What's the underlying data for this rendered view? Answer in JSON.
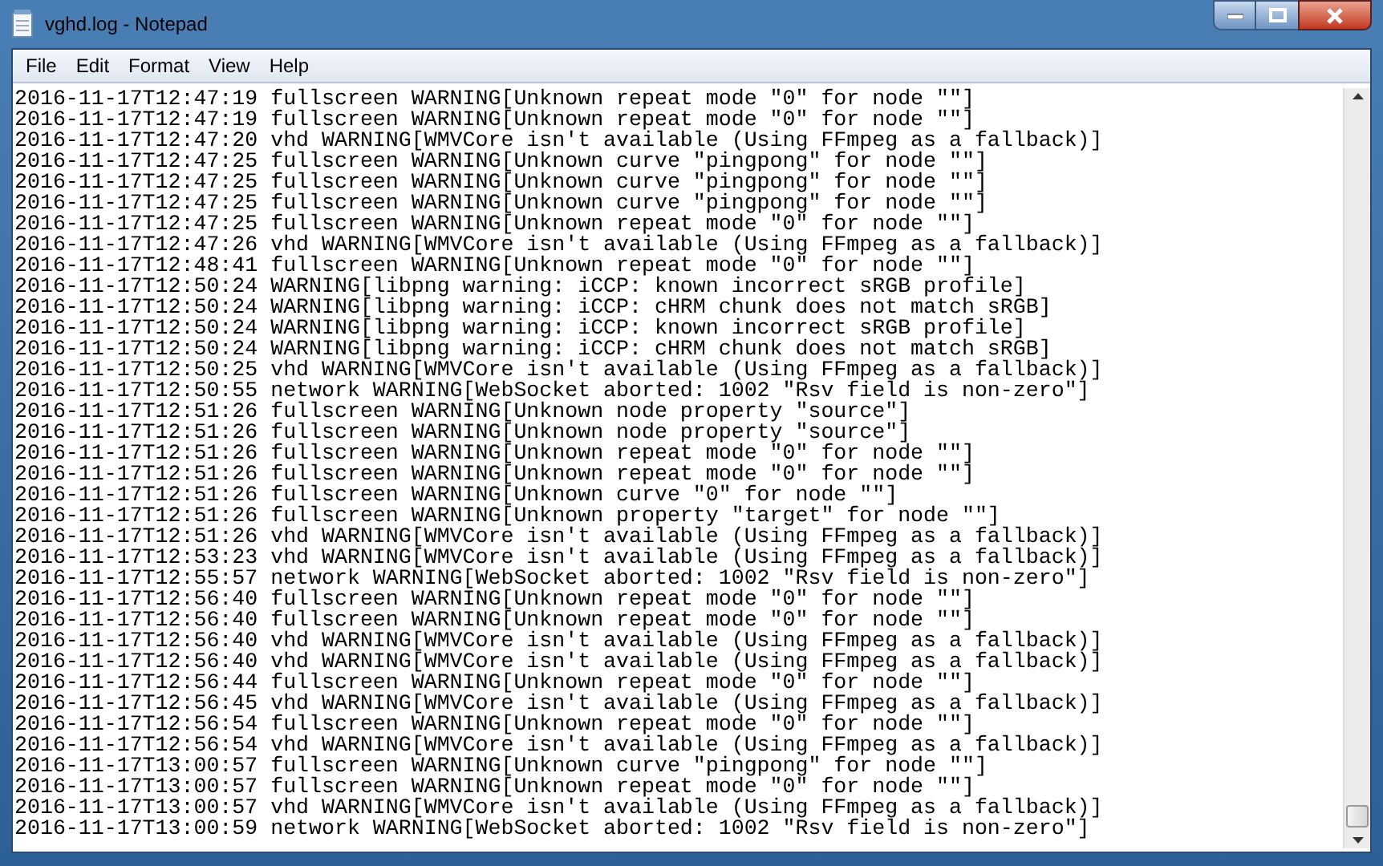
{
  "window": {
    "title": "vghd.log - Notepad"
  },
  "menu": [
    "File",
    "Edit",
    "Format",
    "View",
    "Help"
  ],
  "lines": [
    "2016-11-17T12:47:19 fullscreen WARNING[Unknown repeat mode \"0\" for node \"\"]",
    "2016-11-17T12:47:19 fullscreen WARNING[Unknown repeat mode \"0\" for node \"\"]",
    "2016-11-17T12:47:20 vhd WARNING[WMVCore isn't available (Using FFmpeg as a fallback)]",
    "2016-11-17T12:47:25 fullscreen WARNING[Unknown curve \"pingpong\" for node \"\"]",
    "2016-11-17T12:47:25 fullscreen WARNING[Unknown curve \"pingpong\" for node \"\"]",
    "2016-11-17T12:47:25 fullscreen WARNING[Unknown curve \"pingpong\" for node \"\"]",
    "2016-11-17T12:47:25 fullscreen WARNING[Unknown repeat mode \"0\" for node \"\"]",
    "2016-11-17T12:47:26 vhd WARNING[WMVCore isn't available (Using FFmpeg as a fallback)]",
    "2016-11-17T12:48:41 fullscreen WARNING[Unknown repeat mode \"0\" for node \"\"]",
    "2016-11-17T12:50:24 WARNING[libpng warning: iCCP: known incorrect sRGB profile]",
    "2016-11-17T12:50:24 WARNING[libpng warning: iCCP: cHRM chunk does not match sRGB]",
    "2016-11-17T12:50:24 WARNING[libpng warning: iCCP: known incorrect sRGB profile]",
    "2016-11-17T12:50:24 WARNING[libpng warning: iCCP: cHRM chunk does not match sRGB]",
    "2016-11-17T12:50:25 vhd WARNING[WMVCore isn't available (Using FFmpeg as a fallback)]",
    "2016-11-17T12:50:55 network WARNING[WebSocket aborted: 1002 \"Rsv field is non-zero\"]",
    "2016-11-17T12:51:26 fullscreen WARNING[Unknown node property \"source\"]",
    "2016-11-17T12:51:26 fullscreen WARNING[Unknown node property \"source\"]",
    "2016-11-17T12:51:26 fullscreen WARNING[Unknown repeat mode \"0\" for node \"\"]",
    "2016-11-17T12:51:26 fullscreen WARNING[Unknown repeat mode \"0\" for node \"\"]",
    "2016-11-17T12:51:26 fullscreen WARNING[Unknown curve \"0\" for node \"\"]",
    "2016-11-17T12:51:26 fullscreen WARNING[Unknown property \"target\" for node \"\"]",
    "2016-11-17T12:51:26 vhd WARNING[WMVCore isn't available (Using FFmpeg as a fallback)]",
    "2016-11-17T12:53:23 vhd WARNING[WMVCore isn't available (Using FFmpeg as a fallback)]",
    "2016-11-17T12:55:57 network WARNING[WebSocket aborted: 1002 \"Rsv field is non-zero\"]",
    "2016-11-17T12:56:40 fullscreen WARNING[Unknown repeat mode \"0\" for node \"\"]",
    "2016-11-17T12:56:40 fullscreen WARNING[Unknown repeat mode \"0\" for node \"\"]",
    "2016-11-17T12:56:40 vhd WARNING[WMVCore isn't available (Using FFmpeg as a fallback)]",
    "2016-11-17T12:56:40 vhd WARNING[WMVCore isn't available (Using FFmpeg as a fallback)]",
    "2016-11-17T12:56:44 fullscreen WARNING[Unknown repeat mode \"0\" for node \"\"]",
    "2016-11-17T12:56:45 vhd WARNING[WMVCore isn't available (Using FFmpeg as a fallback)]",
    "2016-11-17T12:56:54 fullscreen WARNING[Unknown repeat mode \"0\" for node \"\"]",
    "2016-11-17T12:56:54 vhd WARNING[WMVCore isn't available (Using FFmpeg as a fallback)]",
    "2016-11-17T13:00:57 fullscreen WARNING[Unknown curve \"pingpong\" for node \"\"]",
    "2016-11-17T13:00:57 fullscreen WARNING[Unknown repeat mode \"0\" for node \"\"]",
    "2016-11-17T13:00:57 vhd WARNING[WMVCore isn't available (Using FFmpeg as a fallback)]",
    "2016-11-17T13:00:59 network WARNING[WebSocket aborted: 1002 \"Rsv field is non-zero\"]"
  ]
}
